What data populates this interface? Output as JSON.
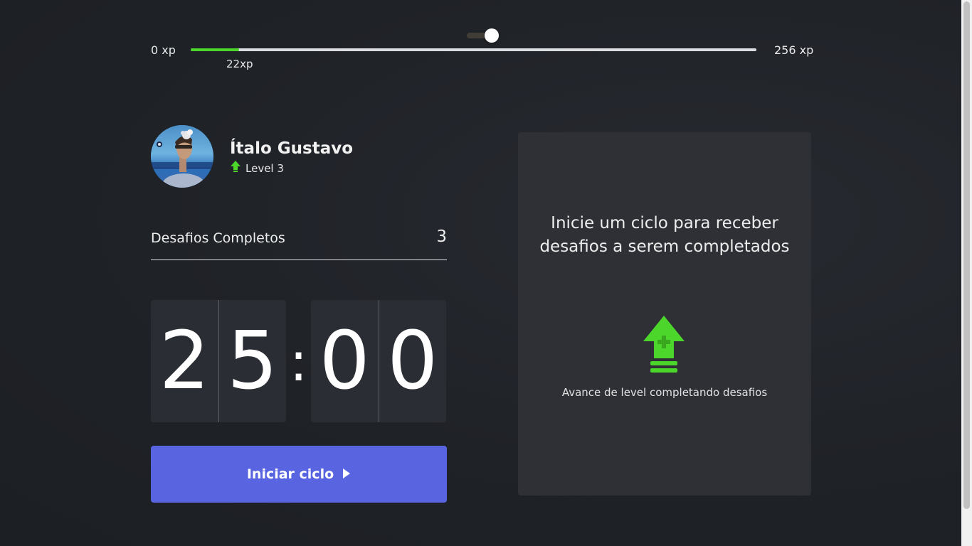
{
  "theme": {
    "accent": "#5965e0",
    "success": "#4cd62b",
    "background": "#1f2227",
    "panel": "#2e3036"
  },
  "theme_toggle": {
    "state": "on",
    "icon": "toggle-switch-icon"
  },
  "experience": {
    "min_label": "0 xp",
    "max_label": "256 xp",
    "current_label": "22xp",
    "current": 22,
    "max": 256
  },
  "profile": {
    "name": "Ítalo Gustavo",
    "level_label": "Level 3",
    "avatar_icon": "user-avatar",
    "level_icon": "level-up-arrow-icon"
  },
  "completed_challenges": {
    "label": "Desafios Completos",
    "count": "3"
  },
  "countdown": {
    "minute_left": "2",
    "minute_right": "5",
    "separator": ":",
    "second_left": "0",
    "second_right": "0"
  },
  "start_button": {
    "label": "Iniciar ciclo",
    "icon": "play-icon"
  },
  "challenge_box": {
    "prompt": "Inicie um ciclo para receber desafios a serem completados",
    "hint": "Avance de level completando desafios",
    "icon": "level-up-icon"
  }
}
